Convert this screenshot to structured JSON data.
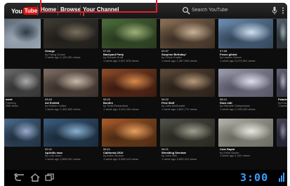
{
  "header": {
    "logo_you": "You",
    "logo_tube": "Tube",
    "nav": {
      "home": "Home",
      "browse": "Browse",
      "channel": "Your Channel"
    },
    "search_placeholder": "Search YouTube"
  },
  "videos": [
    {
      "duration": "",
      "title": "",
      "meta1": "",
      "meta2": ""
    },
    {
      "duration": "",
      "title": "Orange",
      "meta1": "by Flying Goose",
      "meta2": "1 week ago 1,103,301 views"
    },
    {
      "duration": "07:43",
      "title": "Backyard Party",
      "meta1": "by Ronald Groff",
      "meta2": "1 week ago 2,397,978 views"
    },
    {
      "duration": "01:37",
      "title": "Surprise Birthday!",
      "meta1": "by Chloe Fowler",
      "meta2": "1 week ago 1,367,993 views"
    },
    {
      "duration": "07:48",
      "title": "Fence glided",
      "meta1": "by Lauren Grieve",
      "meta2": "1 week ago 5,473,301 views"
    },
    {
      "duration": "",
      "title": "",
      "meta1": "",
      "meta2": ""
    },
    {
      "duration": "",
      "title": "ment",
      "meta1": "Farming",
      "meta2": "398 views"
    },
    {
      "duration": "03:42",
      "title": "Art Exhibit",
      "meta1": "by Kirsten Cullen",
      "meta2": "1 week ago 1,392,600 views"
    },
    {
      "duration": "05:22",
      "title": "Bonfire",
      "meta1": "by Todd Richardson",
      "meta2": "1 week ago 3,101,234 views"
    },
    {
      "duration": "05:22",
      "title": "First Wolf",
      "meta1": "by John McDonald",
      "meta2": "1 week ago 2,891,772 views"
    },
    {
      "duration": "08:12",
      "title": "Slow edit",
      "meta1": "by Michelle Suleymanov",
      "meta2": "1 week ago 2,198,433 views"
    },
    {
      "duration": "",
      "title": "Palade",
      "meta1": "by Eva",
      "meta2": "1 week"
    },
    {
      "duration": "",
      "title": "",
      "meta1": "",
      "meta2": ""
    },
    {
      "duration": "02:21",
      "title": "Ap4x0lu mao",
      "meta1": "by Lola Justo",
      "meta2": "1 week ago 2,898,001 views"
    },
    {
      "duration": "05:21",
      "title": "California 2010",
      "meta1": "by Anton Borsov",
      "meta2": "1 week ago 5,398,119 views"
    },
    {
      "duration": "05:21",
      "title": "Wrestling Seminar",
      "meta1": "by John Wei",
      "meta2": "1 week ago 3,899,110 views"
    },
    {
      "duration": "",
      "title": "Cute Rapid",
      "meta1": "by Kellie Bower",
      "meta2": "1 week ago 1,432 views"
    },
    {
      "duration": "",
      "title": "",
      "meta1": "",
      "meta2": ""
    }
  ],
  "system": {
    "clock": "3:00"
  },
  "colors": {
    "brand_red": "#dd1111",
    "clock_blue": "#3aa0ff",
    "annotation_red": "#e0202a"
  }
}
